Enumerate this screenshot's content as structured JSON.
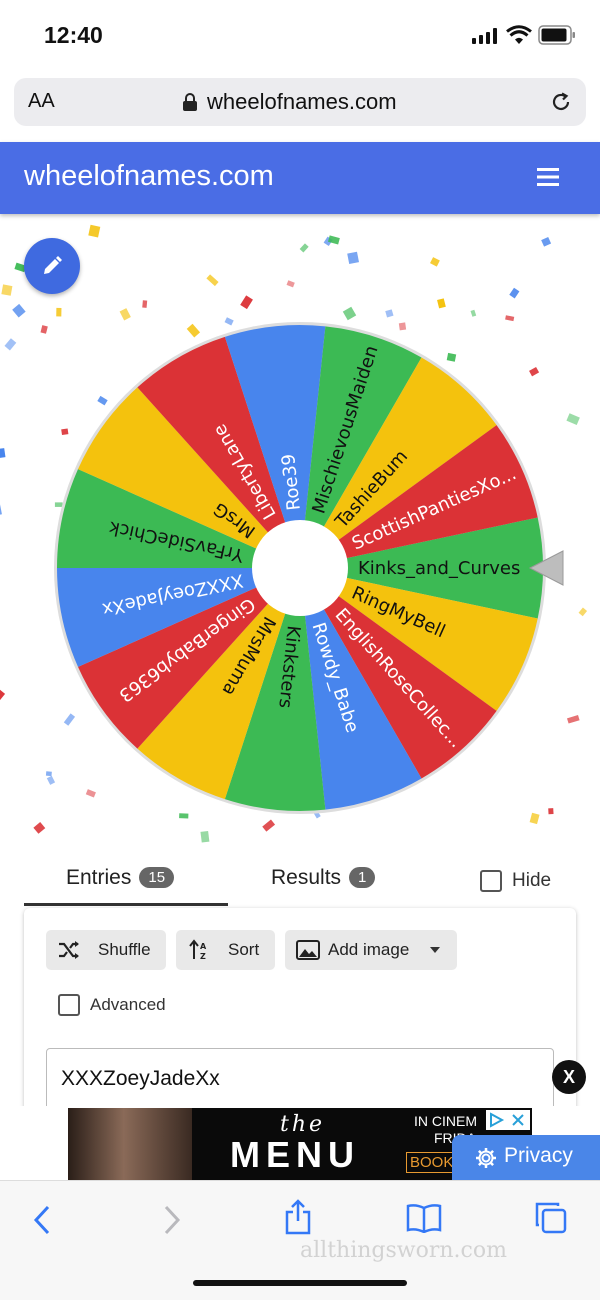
{
  "status_bar": {
    "time": "12:40"
  },
  "browser": {
    "aa_label": "AA",
    "url": "wheelofnames.com"
  },
  "app": {
    "title": "wheelofnames.com"
  },
  "wheel": {
    "colors": [
      "#3cba54",
      "#f4c20d",
      "#db3236",
      "#4885ed"
    ],
    "entries": [
      "Kinks_and_Curves",
      "RingMyBell",
      "EnglishRoseCollec...",
      "Rowdy_Babe",
      "Kinksters",
      "MrsMuma",
      "GingerBabyb6363",
      "XXXZoeyJadeXx",
      "YrFavSideChick",
      "MrsG",
      "LibertyLane",
      "Roe39",
      "MischievousMaiden",
      "TashieBum",
      "ScottishPantiesXo..."
    ]
  },
  "tabs": {
    "entries_label": "Entries",
    "entries_count": "15",
    "results_label": "Results",
    "results_count": "1",
    "hide_label": "Hide"
  },
  "panel": {
    "shuffle_label": "Shuffle",
    "sort_label": "Sort",
    "add_image_label": "Add image",
    "advanced_label": "Advanced",
    "first_entry": "XXXZoeyJadeXx"
  },
  "ad": {
    "close_label": "X",
    "movie_the": "the",
    "movie_title": "MENU",
    "in_cinemas": "IN CINEM",
    "friday": "FRIDA",
    "book": "BOOK",
    "privacy_label": "Privacy"
  },
  "watermark": "allthingsworn.com"
}
